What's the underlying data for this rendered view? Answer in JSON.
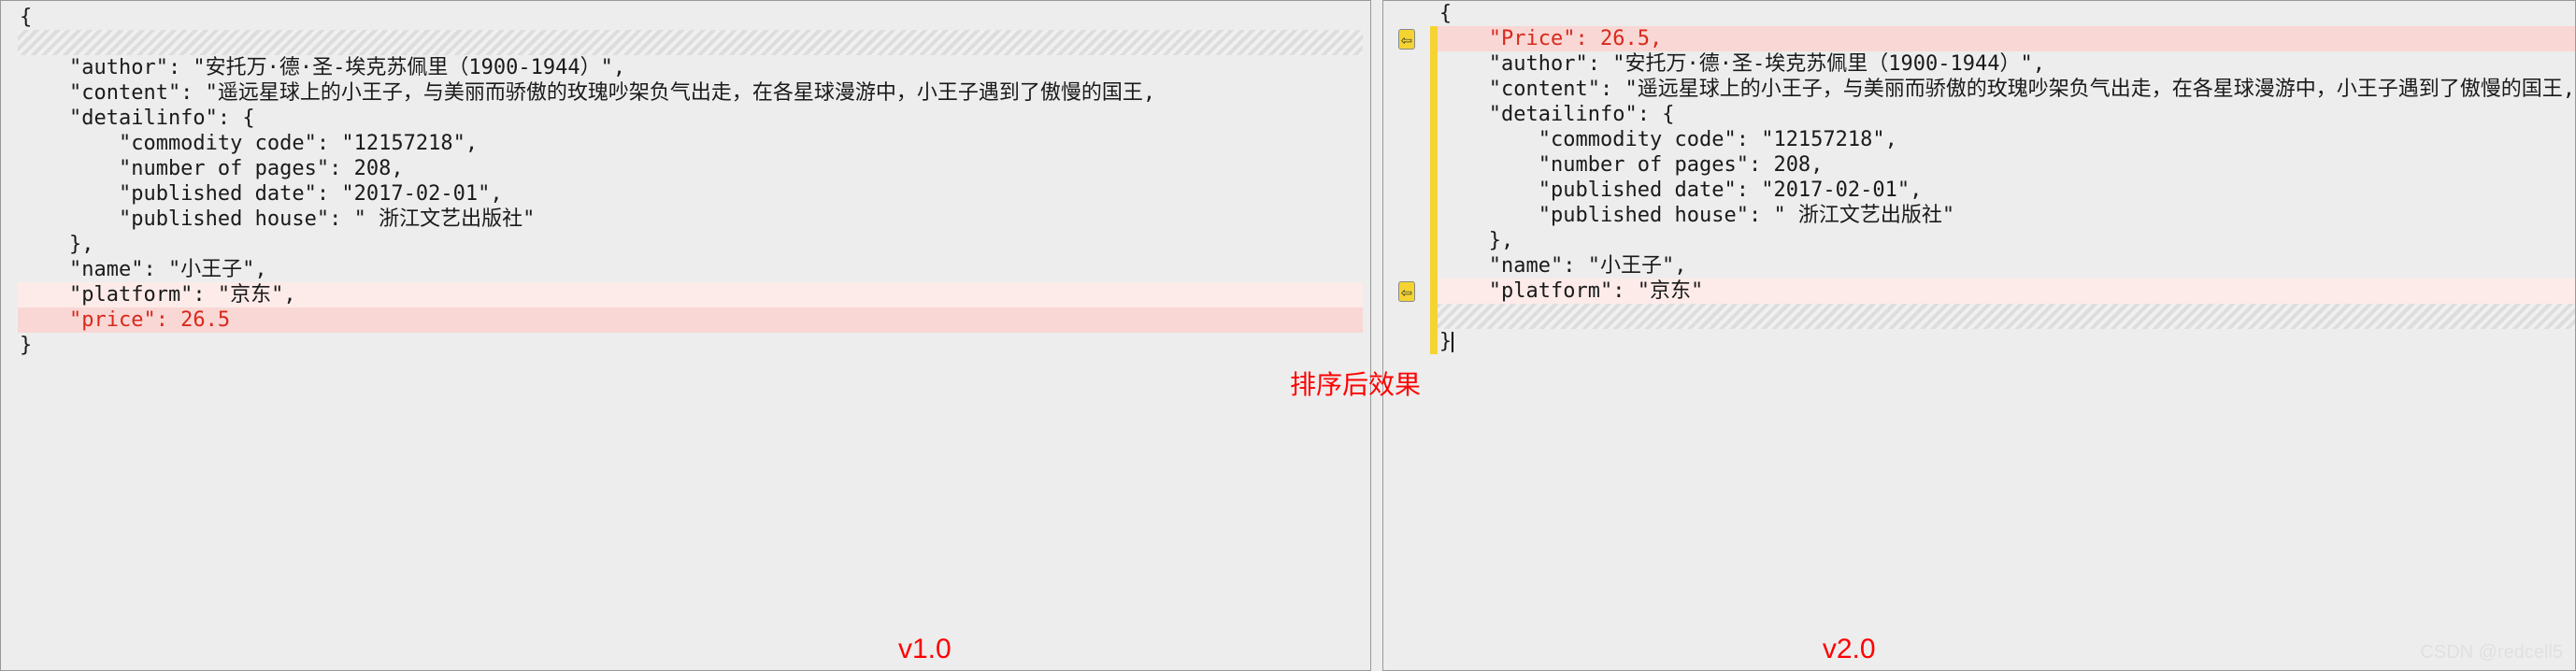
{
  "left": {
    "lines": [
      {
        "text": "{",
        "highlight": "none",
        "red": false
      },
      {
        "text": "",
        "highlight": "hatch",
        "red": false
      },
      {
        "text": "    \"author\": \"安托万·德·圣-埃克苏佩里（1900-1944）\",",
        "highlight": "none",
        "red": false
      },
      {
        "text": "    \"content\": \"遥远星球上的小王子，与美丽而骄傲的玫瑰吵架负气出走，在各星球漫游中，小王子遇到了傲慢的国王,",
        "highlight": "none",
        "red": false
      },
      {
        "text": "    \"detailinfo\": {",
        "highlight": "none",
        "red": false
      },
      {
        "text": "        \"commodity code\": \"12157218\",",
        "highlight": "none",
        "red": false
      },
      {
        "text": "        \"number of pages\": 208,",
        "highlight": "none",
        "red": false
      },
      {
        "text": "        \"published date\": \"2017-02-01\",",
        "highlight": "none",
        "red": false
      },
      {
        "text": "        \"published house\": \" 浙江文艺出版社\"",
        "highlight": "none",
        "red": false
      },
      {
        "text": "    },",
        "highlight": "none",
        "red": false
      },
      {
        "text": "    \"name\": \"小王子\",",
        "highlight": "none",
        "red": false
      },
      {
        "text": "    \"platform\": \"京东\",",
        "highlight": "lightpink",
        "red": false
      },
      {
        "text": "    \"price\": 26.5",
        "highlight": "pink",
        "red": true
      },
      {
        "text": "}",
        "highlight": "none",
        "red": false
      }
    ],
    "version": "v1.0"
  },
  "right": {
    "lines": [
      {
        "text": "{",
        "highlight": "none",
        "red": false,
        "arrow": false,
        "bar": false
      },
      {
        "text": "    \"Price\": 26.5,",
        "highlight": "pink",
        "red": true,
        "arrow": true,
        "bar": true
      },
      {
        "text": "    \"author\": \"安托万·德·圣-埃克苏佩里（1900-1944）\",",
        "highlight": "none",
        "red": false,
        "arrow": false,
        "bar": true
      },
      {
        "text": "    \"content\": \"遥远星球上的小王子，与美丽而骄傲的玫瑰吵架负气出走，在各星球漫游中，小王子遇到了傲慢的国王,",
        "highlight": "none",
        "red": false,
        "arrow": false,
        "bar": true
      },
      {
        "text": "    \"detailinfo\": {",
        "highlight": "none",
        "red": false,
        "arrow": false,
        "bar": true
      },
      {
        "text": "        \"commodity code\": \"12157218\",",
        "highlight": "none",
        "red": false,
        "arrow": false,
        "bar": true
      },
      {
        "text": "        \"number of pages\": 208,",
        "highlight": "none",
        "red": false,
        "arrow": false,
        "bar": true
      },
      {
        "text": "        \"published date\": \"2017-02-01\",",
        "highlight": "none",
        "red": false,
        "arrow": false,
        "bar": true
      },
      {
        "text": "        \"published house\": \" 浙江文艺出版社\"",
        "highlight": "none",
        "red": false,
        "arrow": false,
        "bar": true
      },
      {
        "text": "    },",
        "highlight": "none",
        "red": false,
        "arrow": false,
        "bar": true
      },
      {
        "text": "    \"name\": \"小王子\",",
        "highlight": "none",
        "red": false,
        "arrow": false,
        "bar": true
      },
      {
        "text": "    \"platform\": \"京东\"",
        "highlight": "lightpink",
        "red": false,
        "arrow": true,
        "bar": true
      },
      {
        "text": "",
        "highlight": "hatch",
        "red": false,
        "arrow": false,
        "bar": true
      },
      {
        "text": "}",
        "highlight": "none",
        "red": false,
        "arrow": false,
        "bar": true,
        "cursor": true
      }
    ],
    "version": "v2.0"
  },
  "caption": "排序后效果",
  "watermark": "CSDN @redcell5"
}
